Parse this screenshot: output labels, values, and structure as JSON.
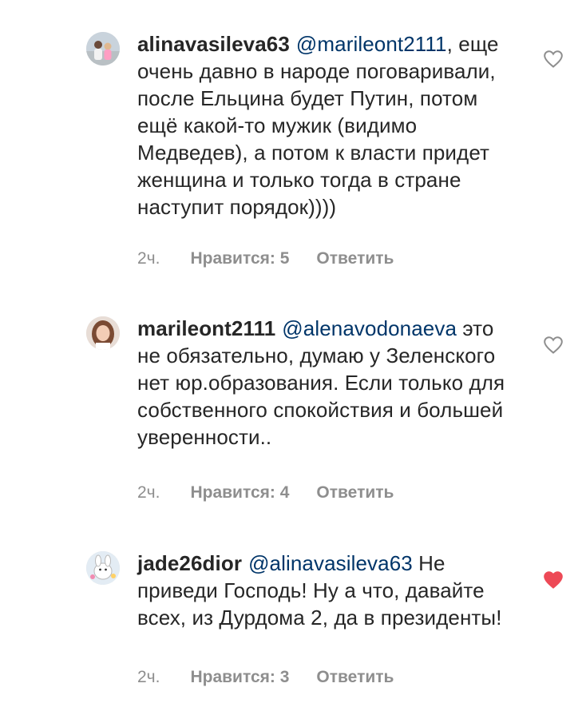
{
  "comments": [
    {
      "username": "alinavasileva63",
      "mention": "@marileont2111",
      "text": ", еще очень давно в народе поговаривали, после Ельцина будет Путин, потом ещё какой-то мужик (видимо Медведев), а потом к власти придет женщина и только тогда в стране наступит порядок))))",
      "time": "2ч.",
      "likes": "Нравится: 5",
      "reply": "Ответить",
      "liked": false,
      "avatar_icon": "user-photo-two-people"
    },
    {
      "username": "marileont2111",
      "mention": "@alenavodonaeva",
      "text": " это не обязательно, думаю у Зеленского нет юр.образования. Если только для собственного спокойствия и большей уверенности..",
      "time": "2ч.",
      "likes": "Нравится: 4",
      "reply": "Ответить",
      "liked": false,
      "avatar_icon": "user-photo-woman"
    },
    {
      "username": "jade26dior",
      "mention": "@alinavasileva63",
      "text": " Не приведи Господь! Ну а что, давайте всех, из Дурдома 2, да в президенты!",
      "time": "2ч.",
      "likes": "Нравится: 3",
      "reply": "Ответить",
      "liked": true,
      "avatar_icon": "user-avatar-cartoon"
    }
  ],
  "colors": {
    "text": "#262626",
    "mention": "#003569",
    "meta": "#8e8e8e",
    "heart_outline": "#8e8e8e",
    "heart_liked": "#ed4956"
  }
}
